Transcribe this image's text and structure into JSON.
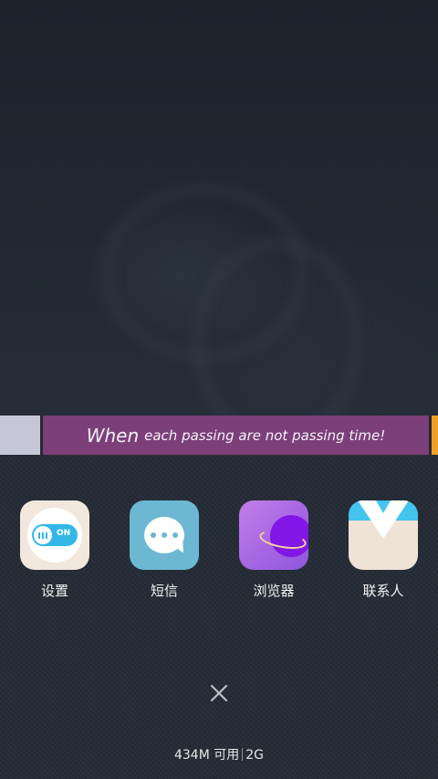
{
  "recent_task": {
    "banner_big": "When",
    "banner_small": "each passing are not passing time!",
    "colors": {
      "left_card": "#c6c7d6",
      "main_card": "#7c3f7a",
      "right_card": "#f0a021"
    }
  },
  "apps": [
    {
      "label": "设置",
      "icon": "toggle-switch-icon",
      "badge_text": "ON"
    },
    {
      "label": "短信",
      "icon": "message-bubble-icon"
    },
    {
      "label": "浏览器",
      "icon": "planet-orbit-icon"
    },
    {
      "label": "联系人",
      "icon": "shirt-collar-icon"
    }
  ],
  "close_button": {
    "icon": "close-x-icon"
  },
  "memory_info": {
    "available": "434M 可用",
    "network": "2G"
  }
}
